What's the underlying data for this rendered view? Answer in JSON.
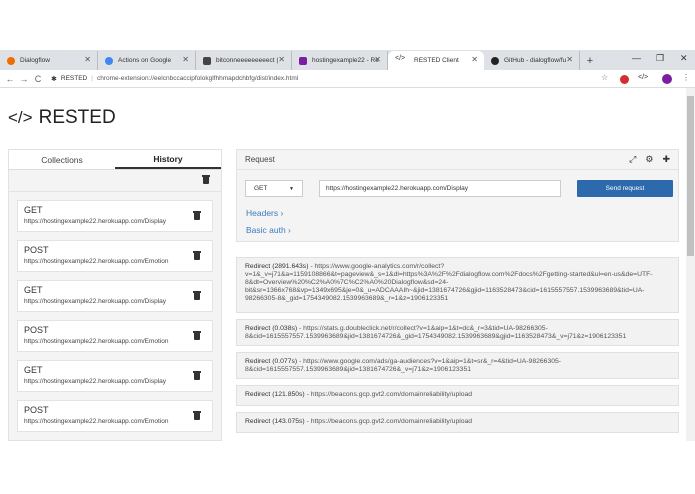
{
  "browser": {
    "tabs": [
      {
        "title": "Dialogflow",
        "color": "#ef6c00"
      },
      {
        "title": "Actions on Google",
        "color": "#4285f4"
      },
      {
        "title": "bitconneeeeeeeeect |",
        "color": "#444444"
      },
      {
        "title": "hostingexample22 - Re",
        "color": "#7b1fa2"
      },
      {
        "title": "RESTED Client",
        "color": "#333333"
      },
      {
        "title": "GitHub - dialogflow/fu",
        "color": "#222222"
      }
    ],
    "address": {
      "site": "RESTED",
      "url": "chrome-extension://eelcnbccaccipfolokglfhhmapdchbfg/dist/index.html"
    }
  },
  "app": {
    "title": "RESTED",
    "logo": "</>"
  },
  "left": {
    "tab_collections": "Collections",
    "tab_history": "History",
    "history": [
      {
        "method": "GET",
        "url": "https://hostingexample22.herokuapp.com/Display"
      },
      {
        "method": "POST",
        "url": "https://hostingexample22.herokuapp.com/Emotion"
      },
      {
        "method": "GET",
        "url": "https://hostingexample22.herokuapp.com/Display"
      },
      {
        "method": "POST",
        "url": "https://hostingexample22.herokuapp.com/Emotion"
      },
      {
        "method": "GET",
        "url": "https://hostingexample22.herokuapp.com/Display"
      },
      {
        "method": "POST",
        "url": "https://hostingexample22.herokuapp.com/Emotion"
      }
    ]
  },
  "request": {
    "header": "Request",
    "method": "GET",
    "url": "https://hostingexample22.herokuapp.com/Display",
    "send": "Send request",
    "headers_link": "Headers ›",
    "basic_auth_link": "Basic auth ›"
  },
  "redirects": [
    {
      "time": "Redirect (2891.643s)",
      "text": " - https://www.google-analytics.com/r/collect?v=1&_v=j71&a=1159108866&t=pageview&_s=1&dl=https%3A%2F%2Fdialogflow.com%2Fdocs%2Fgetting-started&ul=en-us&de=UTF-8&dt=Overview%20%C2%A0%7C%C2%A0%20Dialogflow&sd=24-bit&sr=1366x768&vp=1349x695&je=0&_u=ADCAAAIh~&jid=1381674726&gjid=1163528473&cid=1615557557.1539963689&tid=UA-98266305-8&_gid=1754349082.1539963689&_r=1&z=1906123351"
    },
    {
      "time": "Redirect (0.038s)",
      "text": " - https://stats.g.doubleclick.net/r/collect?v=1&aip=1&t=dc&_r=3&tid=UA-98266305-8&cid=1615557557.1539963689&jid=1381674726&_gid=1754349082.1539963689&gjid=1163528473&_v=j71&z=1906123351"
    },
    {
      "time": "Redirect (0.077s)",
      "text": " - https://www.google.com/ads/ga-audiences?v=1&aip=1&t=sr&_r=4&tid=UA-98266305-8&cid=1615557557.1539963689&jid=1381674726&_v=j71&z=1906123351"
    },
    {
      "time": "Redirect (121.850s)",
      "text": " - https://beacons.gcp.gvt2.com/domainreliability/upload"
    },
    {
      "time": "Redirect (143.075s)",
      "text": " - https://beacons.gcp.gvt2.com/domainreliability/upload"
    }
  ]
}
